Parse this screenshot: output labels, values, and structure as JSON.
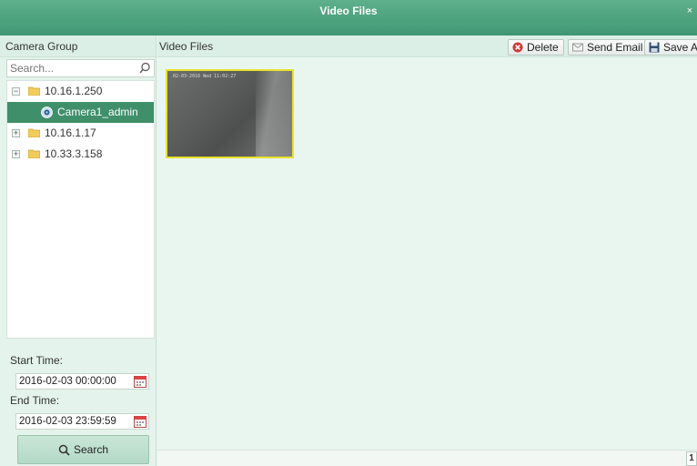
{
  "window": {
    "title": "Video Files",
    "close_glyph": "×"
  },
  "sidebar": {
    "header": "Camera Group",
    "search": {
      "placeholder": "Search..."
    },
    "tree": [
      {
        "label": "10.16.1.250",
        "expanded": true,
        "children": [
          {
            "label": "Camera1_admin",
            "selected": true
          }
        ]
      },
      {
        "label": "10.16.1.17",
        "expanded": false
      },
      {
        "label": "10.33.3.158",
        "expanded": false
      }
    ],
    "start_label": "Start Time:",
    "start_value": "2016-02-03 00:00:00",
    "end_label": "End Time:",
    "end_value": "2016-02-03 23:59:59",
    "search_button": "Search"
  },
  "main": {
    "header": "Video Files",
    "toolbar": {
      "delete": "Delete",
      "send_email": "Send Email",
      "save_as": "Save As"
    },
    "thumbnail": {
      "osd": "02-03-2016 Wed 11:02:27"
    },
    "pagination": {
      "page": "1"
    }
  },
  "colors": {
    "accent": "#3f9672",
    "selected_row": "#3f8f6a",
    "thumb_border": "#e8e22a"
  }
}
